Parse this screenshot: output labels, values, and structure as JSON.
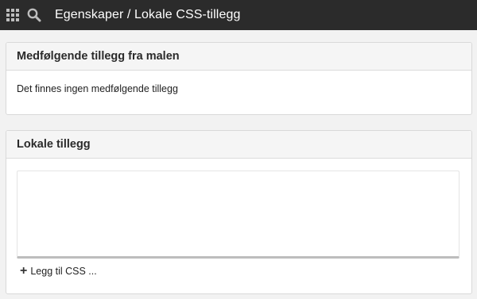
{
  "header": {
    "title": "Egenskaper / Lokale CSS-tillegg",
    "apps_icon": "grid-icon",
    "search_icon": "search-icon"
  },
  "bundled_panel": {
    "heading": "Medfølgende tillegg fra malen",
    "empty_text": "Det finnes ingen medfølgende tillegg"
  },
  "local_panel": {
    "heading": "Lokale tillegg",
    "editor_value": "",
    "add_label": "Legg til CSS ..."
  },
  "colors": {
    "topbar": "#2b2b2b",
    "page_background": "#f2f2f2",
    "panel_heading": "#f5f5f5"
  }
}
